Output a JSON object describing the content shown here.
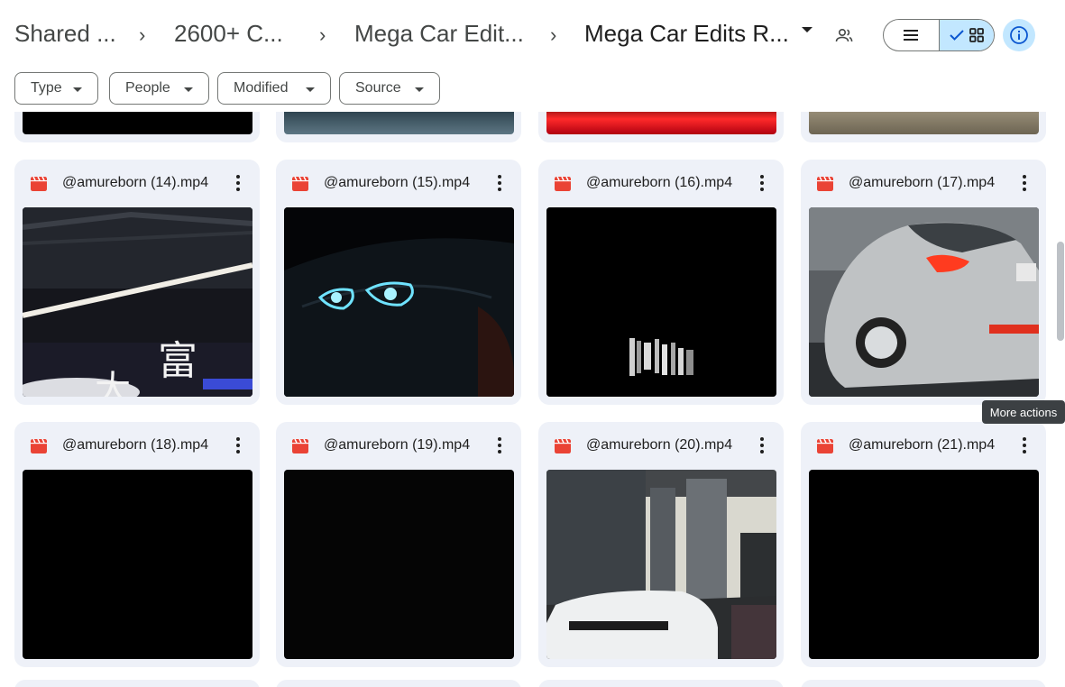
{
  "breadcrumbs": {
    "item1": "Shared ...",
    "item2": "2600+ C...",
    "item3": "Mega Car Edit...",
    "current": "Mega Car Edits R...",
    "separator": "›"
  },
  "toolbar": {
    "list_view_icon": "list-icon",
    "grid_view_icon": "grid-icon",
    "grid_view_selected": true,
    "info_icon": "info-icon",
    "share_icon": "people-icon"
  },
  "filters": [
    {
      "label": "Type"
    },
    {
      "label": "People"
    },
    {
      "label": "Modified"
    },
    {
      "label": "Source"
    }
  ],
  "files": [
    {
      "name": "@amureborn (14).mp4",
      "icon": "video-file-icon"
    },
    {
      "name": "@amureborn (15).mp4",
      "icon": "video-file-icon"
    },
    {
      "name": "@amureborn (16).mp4",
      "icon": "video-file-icon"
    },
    {
      "name": "@amureborn (17).mp4",
      "icon": "video-file-icon"
    },
    {
      "name": "@amureborn (18).mp4",
      "icon": "video-file-icon"
    },
    {
      "name": "@amureborn (19).mp4",
      "icon": "video-file-icon"
    },
    {
      "name": "@amureborn (20).mp4",
      "icon": "video-file-icon"
    },
    {
      "name": "@amureborn (21).mp4",
      "icon": "video-file-icon"
    }
  ],
  "tooltip": "More actions",
  "colors": {
    "accent": "#c2e7ff",
    "card_bg": "#eef1f8",
    "video_icon": "#ea4335"
  }
}
